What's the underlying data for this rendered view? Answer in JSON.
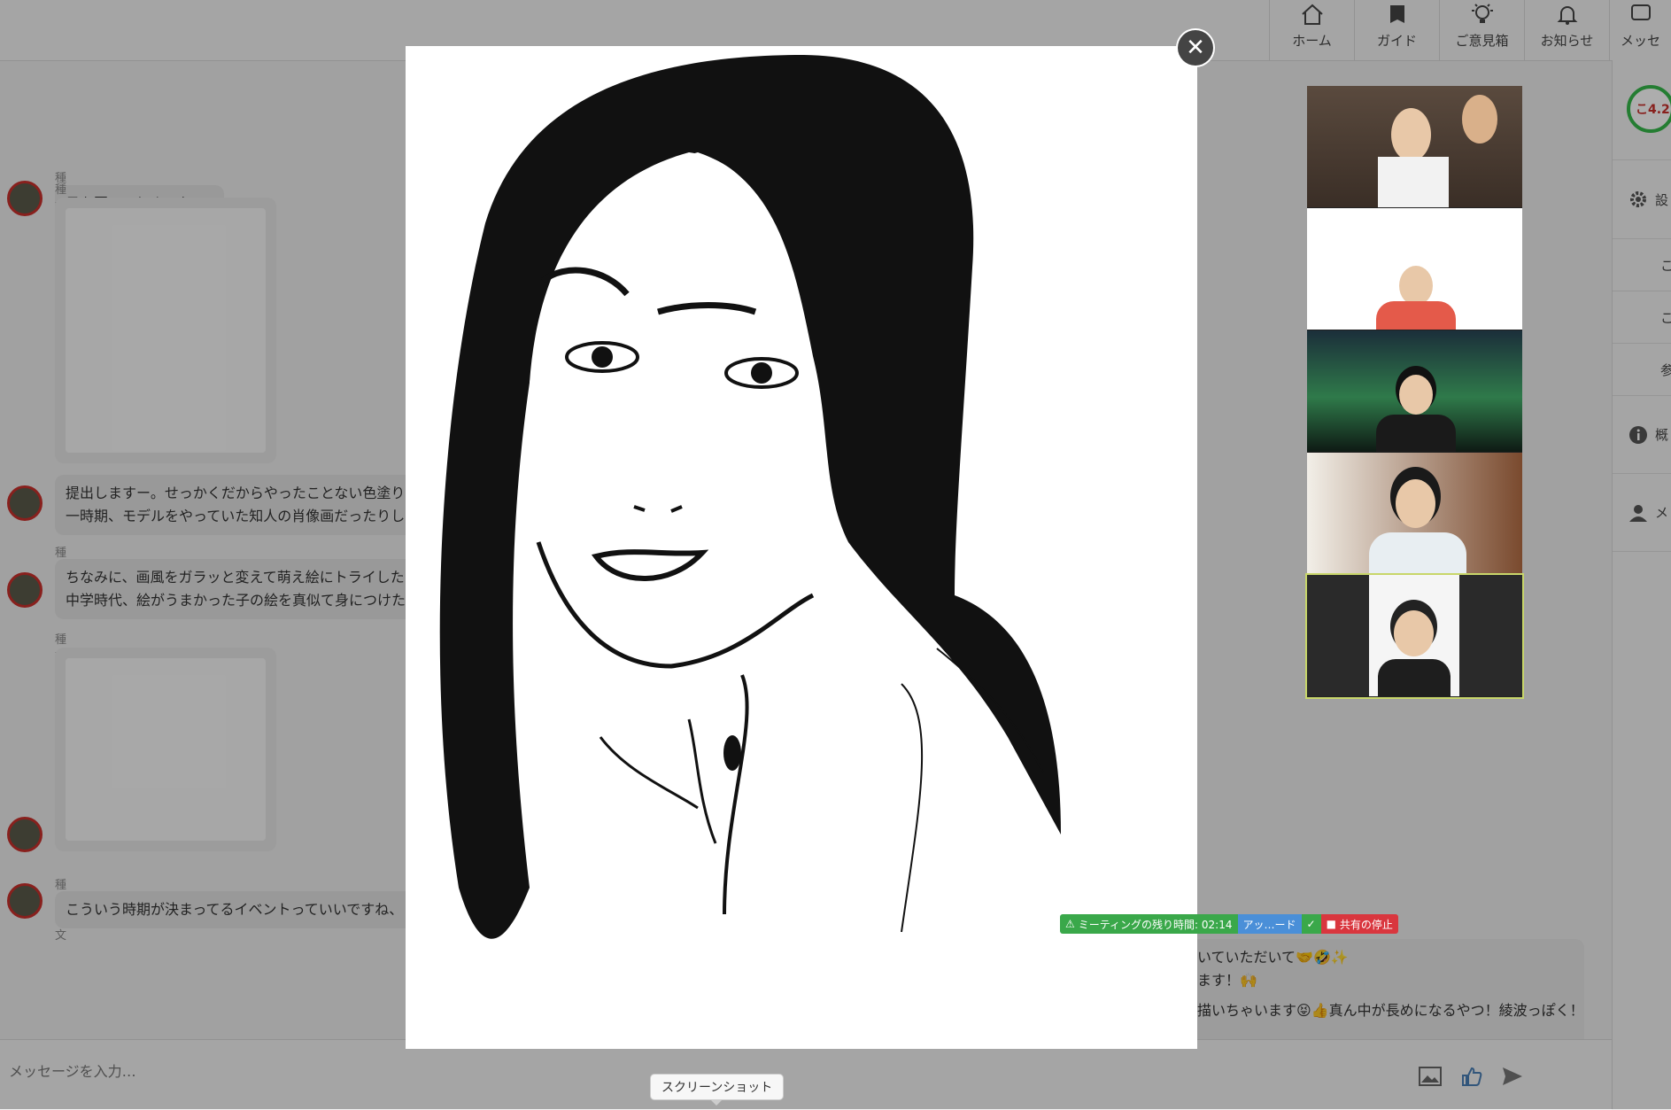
{
  "nav": {
    "items": [
      {
        "label": "ホーム",
        "icon": "home-icon"
      },
      {
        "label": "ガイド",
        "icon": "guide-icon"
      },
      {
        "label": "ご意見箱",
        "icon": "lightbulb-icon"
      },
      {
        "label": "お知らせ",
        "icon": "bell-icon"
      },
      {
        "label": "メッセ",
        "icon": "message-icon"
      }
    ]
  },
  "chat": {
    "messages": [
      {
        "sender": "種市貴文",
        "text": "日を回ってしまった。。"
      },
      {
        "sender": "種市貴文",
        "text": "提出しますー。せっかくだからやったことない色塗り\n一時期、モデルをやっていた知人の肖像画だったりし"
      },
      {
        "sender": "種市貴文",
        "text": "ちなみに、画風をガラッと変えて萌え絵にトライした\n中学時代、絵がうまかった子の絵を真似て身につけた"
      },
      {
        "sender": "種市貴文",
        "text": ""
      },
      {
        "sender": "種市貴文",
        "text": "こういう時期が決まってるイベントっていいですね、"
      }
    ],
    "right_snippets": [
      "いていただいて🤝🤣✨",
      "ます！🙌",
      "描いちゃいます😝👍真ん中が長めになるやつ！綾波っぽく！"
    ]
  },
  "input": {
    "placeholder": "メッセージを入力…"
  },
  "sidebar": {
    "badge": "こ4.2",
    "rows": [
      {
        "icon": "gear-icon",
        "label": "設"
      },
      {
        "icon": "",
        "label": "こ"
      },
      {
        "icon": "",
        "label": "こ"
      },
      {
        "icon": "",
        "label": "参"
      },
      {
        "icon": "info-icon",
        "label": "概"
      },
      {
        "icon": "user-icon",
        "label": "メ"
      }
    ]
  },
  "share_bar": {
    "remaining": "ミーティングの残り時間: 02:14",
    "upgrade": "アッ…ード",
    "stop": "共有の停止"
  },
  "tooltip": {
    "screenshot": "スクリーンショット"
  },
  "colors": {
    "avatar_ring": "#c9302c",
    "active_tile": "#c8d66a",
    "share_green": "#3aa84a",
    "share_red": "#d9363e",
    "share_blue": "#4a8fd8"
  }
}
